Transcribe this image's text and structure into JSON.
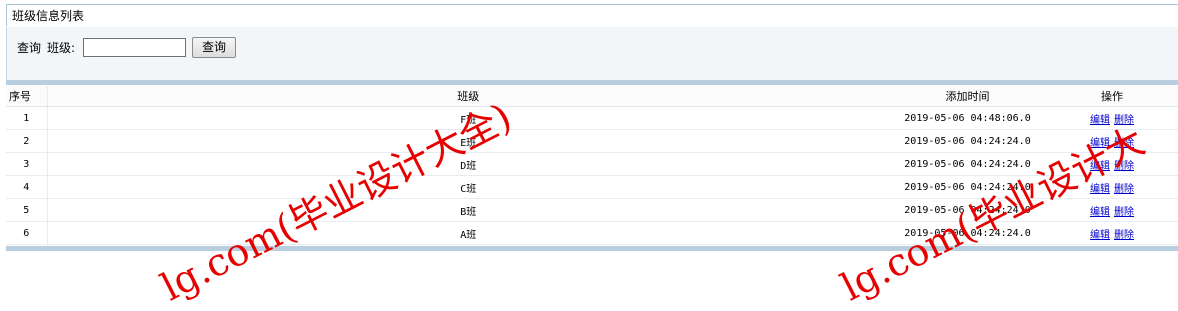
{
  "panel": {
    "title": "班级信息列表"
  },
  "search": {
    "query_label": "查询",
    "class_label": "班级:",
    "input_value": "",
    "button_label": "查询"
  },
  "table": {
    "headers": {
      "index": "序号",
      "class": "班级",
      "time": "添加时间",
      "ops": "操作"
    },
    "rows": [
      {
        "index": "1",
        "class": "F班",
        "time": "2019-05-06 04:48:06.0",
        "edit": "编辑",
        "delete": "删除"
      },
      {
        "index": "2",
        "class": "E班",
        "time": "2019-05-06 04:24:24.0",
        "edit": "编辑",
        "delete": "删除"
      },
      {
        "index": "3",
        "class": "D班",
        "time": "2019-05-06 04:24:24.0",
        "edit": "编辑",
        "delete": "删除"
      },
      {
        "index": "4",
        "class": "C班",
        "time": "2019-05-06 04:24:24.0",
        "edit": "编辑",
        "delete": "删除"
      },
      {
        "index": "5",
        "class": "B班",
        "time": "2019-05-06 04:24:24.0",
        "edit": "编辑",
        "delete": "删除"
      },
      {
        "index": "6",
        "class": "A班",
        "time": "2019-05-06 04:24:24.0",
        "edit": "编辑",
        "delete": "删除"
      }
    ]
  },
  "watermarks": [
    "lg.com(毕业设计大全)",
    "lg.com(毕业设计大"
  ],
  "colors": {
    "watermark": "#e60000",
    "link": "#0000cc",
    "divider": "#b9cfdf"
  }
}
